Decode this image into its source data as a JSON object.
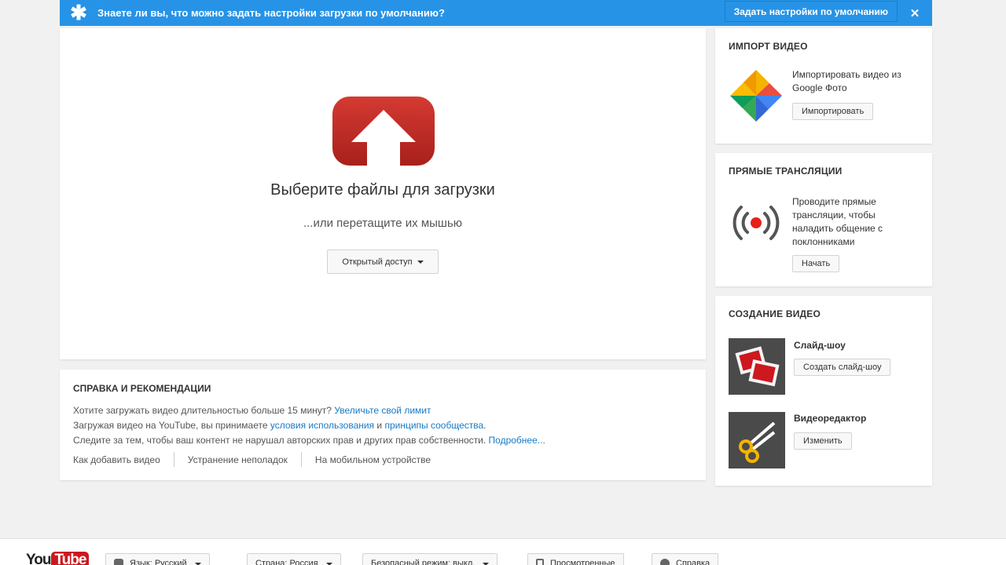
{
  "notice": {
    "text": "Знаете ли вы, что можно задать настройки загрузки по умолчанию?",
    "button_label": "Задать настройки по умолчанию",
    "close_symbol": "✕",
    "star_symbol": "✱"
  },
  "upload": {
    "title": "Выберите файлы для загрузки",
    "subtitle": "...или перетащите их мышью",
    "privacy_label": "Открытый доступ"
  },
  "help": {
    "title": "СПРАВКА И РЕКОМЕНДАЦИИ",
    "line1_text": "Хотите загружать видео длительностью больше 15 минут? ",
    "line1_link": "Увеличьте свой лимит",
    "line2_text": "Загружая видео на YouTube, вы принимаете ",
    "line2_link1": "условия использования",
    "line2_and": " и ",
    "line2_link2": "принципы сообщества",
    "line2_end": ".",
    "line3_text": "Следите за тем, чтобы ваш контент не нарушал авторских прав и других прав собственности. ",
    "line3_link": "Подробнее...",
    "links": [
      "Как добавить видео",
      "Устранение неполадок",
      "На мобильном устройстве"
    ]
  },
  "import_panel": {
    "title": "ИМПОРТ ВИДЕО",
    "text": "Импортировать видео из Google Фото",
    "button_label": "Импортировать",
    "icon": "google-photos-icon"
  },
  "live_panel": {
    "title": "ПРЯМЫЕ ТРАНСЛЯЦИИ",
    "text": "Проводите прямые трансляции, чтобы наладить общение с поклонниками",
    "button_label": "Начать",
    "icon": "live-broadcast-icon"
  },
  "create_panel": {
    "title": "СОЗДАНИЕ ВИДЕО",
    "slideshow_title": "Слайд-шоу",
    "slideshow_button": "Создать слайд-шоу",
    "editor_title": "Видеоредактор",
    "editor_button": "Изменить",
    "icons": [
      "slideshow-icon",
      "scissors-icon"
    ]
  },
  "footer": {
    "logo_you": "You",
    "logo_tube": "Tube",
    "language": "Язык: Русский",
    "country": "Страна: Россия",
    "safe_mode": "Безопасный режим: выкл.",
    "history": "Просмотренные",
    "help": "Справка"
  },
  "colors": {
    "notice_bg": "#2793e6",
    "upload_red": "#c4302b",
    "link": "#167ac6",
    "live_red": "#e62117"
  }
}
